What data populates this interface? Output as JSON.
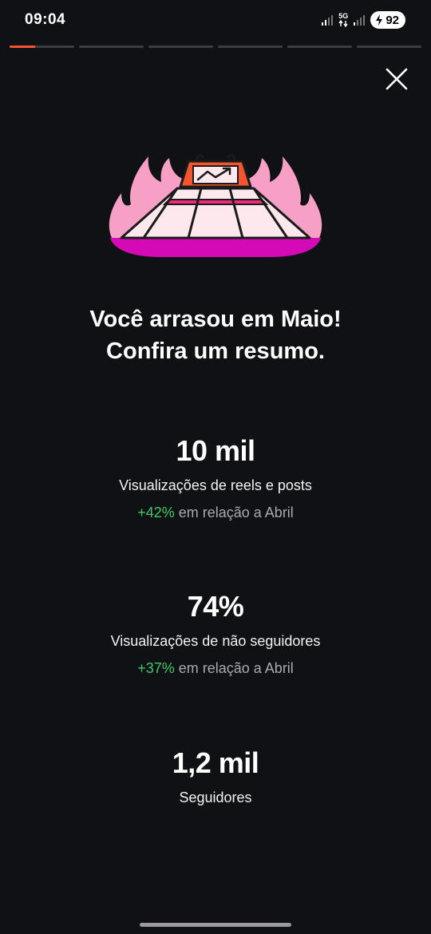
{
  "status_bar": {
    "time": "09:04",
    "network_label": "5G",
    "battery": "92"
  },
  "stories_progress": {
    "segments": 6,
    "active_index": 0,
    "active_fill": 0.4,
    "accent_color": "#f4552e"
  },
  "close": {
    "icon": "close-icon"
  },
  "headline": {
    "line1": "Você arrasou em Maio!",
    "line2": "Confira um resumo."
  },
  "stats": [
    {
      "value": "10 mil",
      "label": "Visualizações de reels e posts",
      "change": "+42%",
      "comparison": " em relação a Abril"
    },
    {
      "value": "74%",
      "label": "Visualizações de não seguidores",
      "change": "+37%",
      "comparison": " em relação a Abril"
    },
    {
      "value": "1,2 mil",
      "label": "Seguidores"
    }
  ],
  "colors": {
    "background": "#0f1115",
    "positive": "#3ccb64",
    "muted": "#a8aaaf"
  }
}
